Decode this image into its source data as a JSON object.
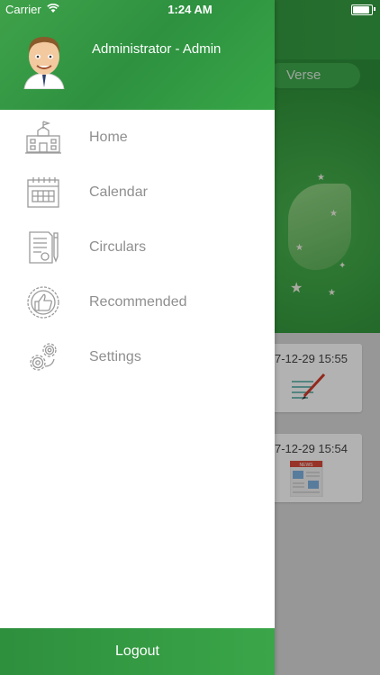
{
  "status_bar": {
    "carrier": "Carrier",
    "time": "1:24 AM"
  },
  "background": {
    "tab_label": "Verse",
    "cards": [
      {
        "time": "7-12-29 15:55",
        "icon": "pencil-notepad-icon"
      },
      {
        "time": "7-12-29 15:54",
        "icon": "newspaper-icon",
        "icon_text": "NEWS"
      }
    ]
  },
  "drawer": {
    "user_name": "Administrator - Admin",
    "menu": [
      {
        "label": "Home",
        "icon": "school-building-icon"
      },
      {
        "label": "Calendar",
        "icon": "calendar-icon"
      },
      {
        "label": "Circulars",
        "icon": "document-pen-icon"
      },
      {
        "label": "Recommended",
        "icon": "thumbs-up-badge-icon"
      },
      {
        "label": "Settings",
        "icon": "gears-icon"
      }
    ],
    "logout_label": "Logout"
  },
  "colors": {
    "accent_green": "#35a044",
    "menu_text": "#8f8f8f",
    "icon_gray": "#9a9a9a"
  }
}
